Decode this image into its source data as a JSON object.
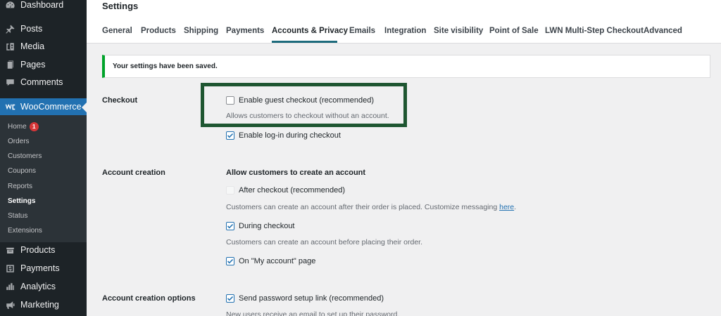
{
  "sidebar": {
    "top": [
      {
        "label": "Dashboard",
        "icon": "dashboard-icon"
      },
      {
        "label": "Posts",
        "icon": "pin-icon"
      },
      {
        "label": "Media",
        "icon": "media-icon"
      },
      {
        "label": "Pages",
        "icon": "pages-icon"
      },
      {
        "label": "Comments",
        "icon": "comment-icon"
      }
    ],
    "woocommerce": {
      "label": "WooCommerce",
      "icon": "woocommerce-icon"
    },
    "submenu": [
      {
        "label": "Home",
        "badge": "1"
      },
      {
        "label": "Orders"
      },
      {
        "label": "Customers"
      },
      {
        "label": "Coupons"
      },
      {
        "label": "Reports"
      },
      {
        "label": "Settings",
        "current": true
      },
      {
        "label": "Status"
      },
      {
        "label": "Extensions"
      }
    ],
    "bottom": [
      {
        "label": "Products",
        "icon": "products-icon"
      },
      {
        "label": "Payments",
        "icon": "payments-icon"
      },
      {
        "label": "Analytics",
        "icon": "analytics-icon"
      },
      {
        "label": "Marketing",
        "icon": "megaphone-icon"
      }
    ],
    "accent_color": "#2271b1"
  },
  "header": {
    "title": "Settings",
    "tabs": [
      "General",
      "Products",
      "Shipping",
      "Payments",
      "Accounts & Privacy",
      "Emails",
      "Integration",
      "Site visibility",
      "Point of Sale",
      "LWN Multi-Step Checkout",
      "Advanced"
    ],
    "active_tab": "Accounts & Privacy"
  },
  "notice": {
    "text": "Your settings have been saved.",
    "color": "#00a32a"
  },
  "form": {
    "checkout": {
      "label": "Checkout",
      "guest": {
        "label": "Enable guest checkout (recommended)",
        "checked": false,
        "description": "Allows customers to checkout without an account."
      },
      "login": {
        "label": "Enable log-in during checkout",
        "checked": true
      }
    },
    "account_creation": {
      "label": "Account creation",
      "heading": "Allow customers to create an account",
      "after_checkout": {
        "label": "After checkout (recommended)",
        "checked": false,
        "disabled": true,
        "description_prefix": "Customers can create an account after their order is placed. Customize messaging ",
        "description_link": "here",
        "description_suffix": "."
      },
      "during_checkout": {
        "label": "During checkout",
        "checked": true,
        "description": "Customers can create an account before placing their order."
      },
      "my_account": {
        "label": "On \"My account\" page",
        "checked": true
      }
    },
    "account_creation_options": {
      "label": "Account creation options",
      "send_password": {
        "label": "Send password setup link (recommended)",
        "checked": true,
        "description": "New users receive an email to set up their password."
      }
    }
  },
  "highlight_color": "#1e5631"
}
